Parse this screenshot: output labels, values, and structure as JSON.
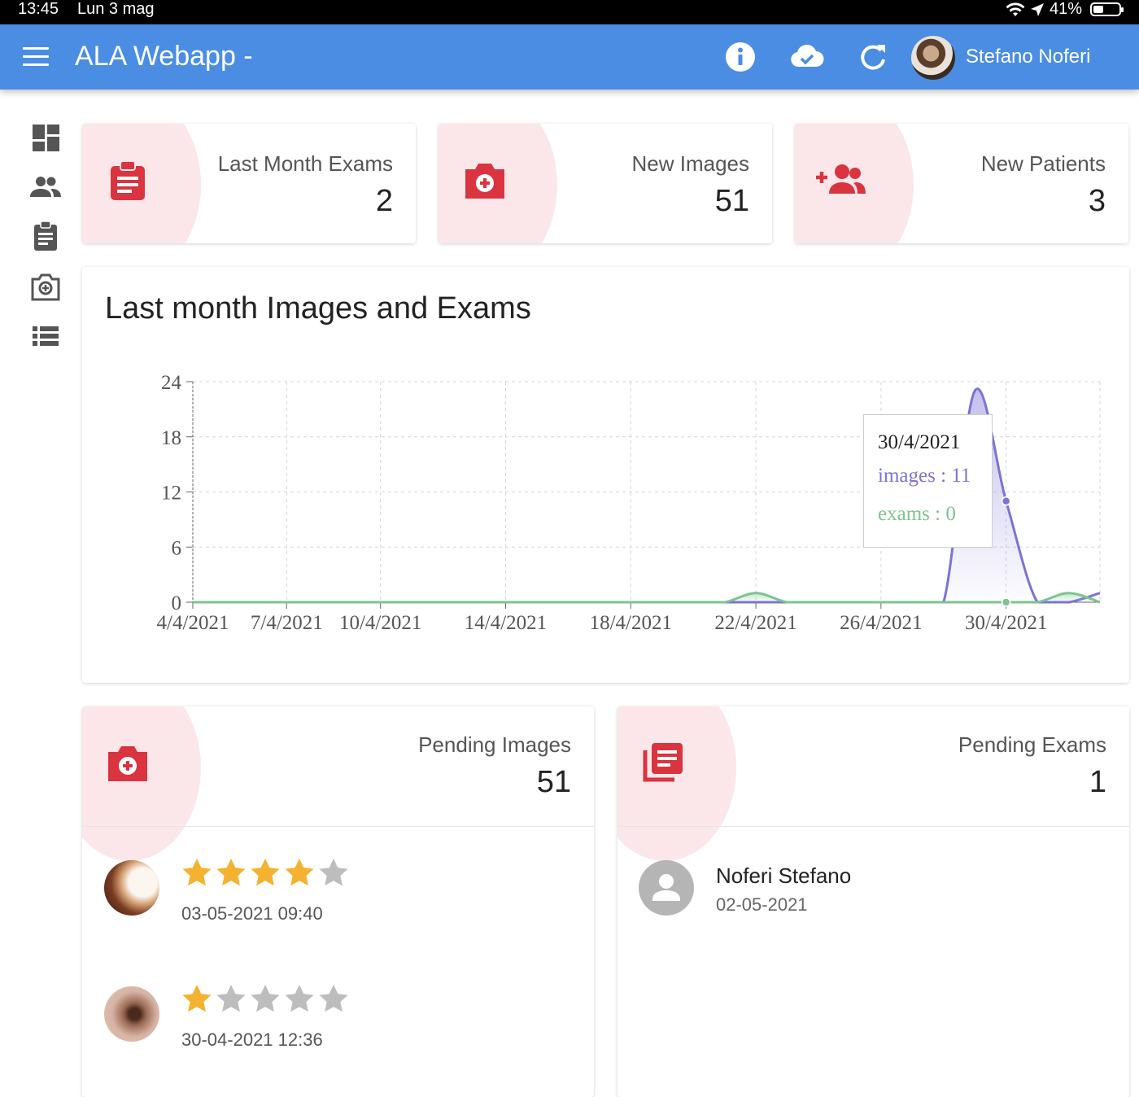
{
  "status_bar": {
    "time": "13:45",
    "date": "Lun 3 mag",
    "battery": "41%"
  },
  "app_bar": {
    "title": "ALA Webapp -",
    "user_name": "Stefano Noferi"
  },
  "stats": {
    "last_month_exams": {
      "label": "Last Month Exams",
      "value": "2"
    },
    "new_images": {
      "label": "New Images",
      "value": "51"
    },
    "new_patients": {
      "label": "New Patients",
      "value": "3"
    }
  },
  "colors": {
    "accent": "#4a8de2",
    "icon_red": "#d9343f",
    "images_series": "#7b73d6",
    "exams_series": "#7dc48f"
  },
  "chart_data": {
    "type": "area",
    "title": "Last month Images and Exams",
    "x": [
      "4/4/2021",
      "5/4/2021",
      "6/4/2021",
      "7/4/2021",
      "8/4/2021",
      "9/4/2021",
      "10/4/2021",
      "11/4/2021",
      "12/4/2021",
      "13/4/2021",
      "14/4/2021",
      "15/4/2021",
      "16/4/2021",
      "17/4/2021",
      "18/4/2021",
      "19/4/2021",
      "20/4/2021",
      "21/4/2021",
      "22/4/2021",
      "23/4/2021",
      "24/4/2021",
      "25/4/2021",
      "26/4/2021",
      "27/4/2021",
      "28/4/2021",
      "29/4/2021",
      "30/4/2021",
      "1/5/2021",
      "2/5/2021",
      "3/5/2021"
    ],
    "x_ticks": [
      "4/4/2021",
      "7/4/2021",
      "10/4/2021",
      "14/4/2021",
      "18/4/2021",
      "22/4/2021",
      "26/4/2021",
      "30/4/2021"
    ],
    "y_ticks": [
      "0",
      "6",
      "12",
      "18",
      "24"
    ],
    "ylim": [
      0,
      24
    ],
    "grid": true,
    "series": [
      {
        "name": "images",
        "values": [
          0,
          0,
          0,
          0,
          0,
          0,
          0,
          0,
          0,
          0,
          0,
          0,
          0,
          0,
          0,
          0,
          0,
          0,
          0,
          0,
          0,
          0,
          0,
          0,
          0,
          23,
          11,
          0,
          0,
          1
        ]
      },
      {
        "name": "exams",
        "values": [
          0,
          0,
          0,
          0,
          0,
          0,
          0,
          0,
          0,
          0,
          0,
          0,
          0,
          0,
          0,
          0,
          0,
          0,
          1,
          0,
          0,
          0,
          0,
          0,
          0,
          0,
          0,
          0,
          1,
          0
        ]
      }
    ],
    "tooltip": {
      "date": "30/4/2021",
      "images": "images : 11",
      "exams": "exams : 0"
    }
  },
  "pending_images": {
    "label": "Pending Images",
    "value": "51",
    "items": [
      {
        "rating": 4,
        "datetime": "03-05-2021 09:40"
      },
      {
        "rating": 1,
        "datetime": "30-04-2021 12:36"
      }
    ]
  },
  "pending_exams": {
    "label": "Pending Exams",
    "value": "1",
    "items": [
      {
        "name": "Noferi Stefano",
        "date": "02-05-2021"
      }
    ]
  }
}
